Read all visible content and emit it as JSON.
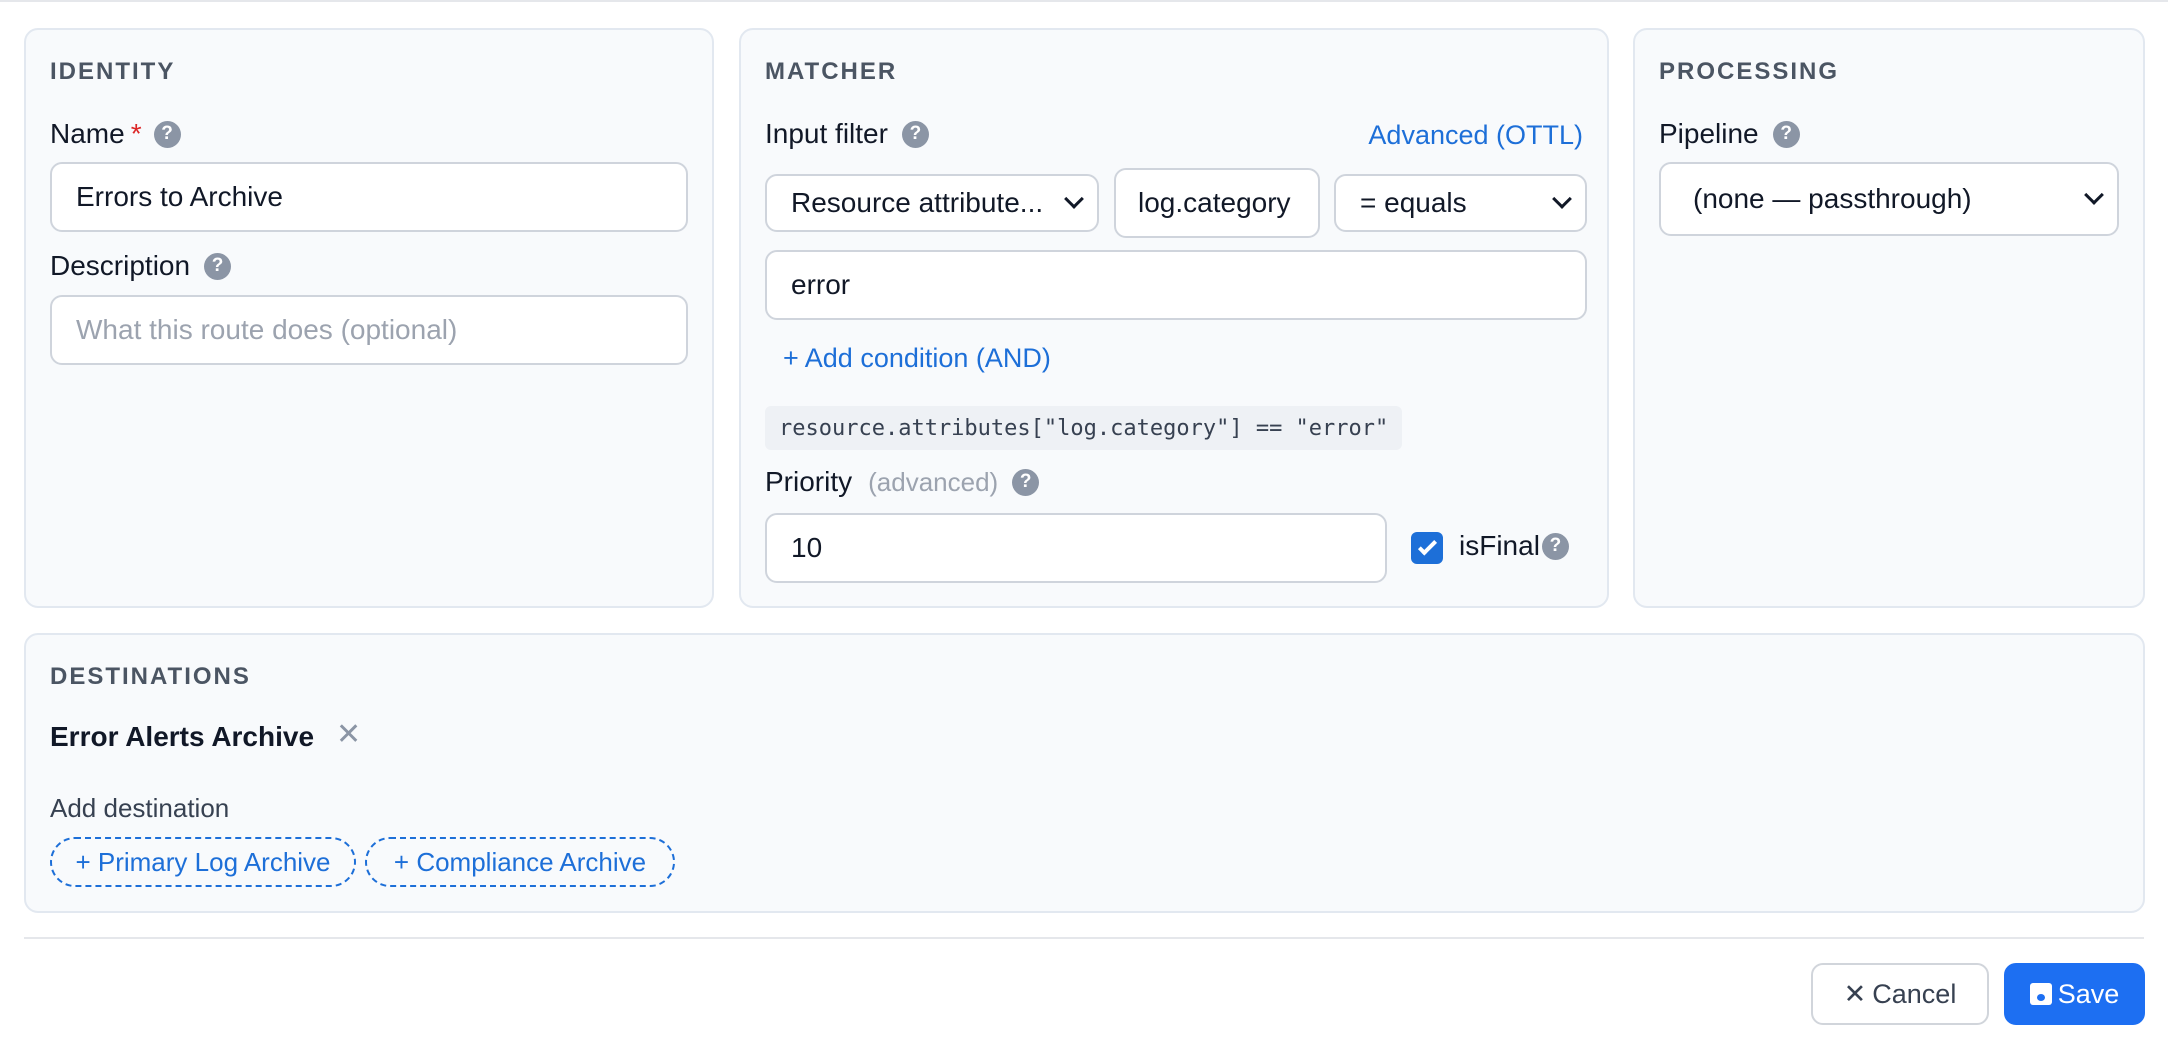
{
  "identity": {
    "title": "IDENTITY",
    "name_label": "Name",
    "required_mark": "*",
    "name_value": "Errors to Archive",
    "description_label": "Description",
    "description_placeholder": "What this route does (optional)"
  },
  "matcher": {
    "title": "MATCHER",
    "input_filter_label": "Input filter",
    "advanced_link": "Advanced (OTTL)",
    "source_select": "Resource attribute...",
    "key_value": "log.category",
    "operator_select": "= equals",
    "value": "error",
    "add_condition": "+ Add condition (AND)",
    "expression": "resource.attributes[\"log.category\"] == \"error\"",
    "priority_label": "Priority",
    "priority_hint": "(advanced)",
    "priority_value": "10",
    "is_final_label": "isFinal",
    "is_final_checked": true
  },
  "processing": {
    "title": "PROCESSING",
    "pipeline_label": "Pipeline",
    "pipeline_select": "(none — passthrough)"
  },
  "destinations": {
    "title": "DESTINATIONS",
    "selected": [
      "Error Alerts Archive"
    ],
    "add_label": "Add destination",
    "options": [
      "+ Primary Log Archive",
      "+ Compliance Archive"
    ]
  },
  "footer": {
    "cancel_label": "Cancel",
    "save_label": "Save"
  },
  "help_glyph": "?",
  "colors": {
    "accent": "#1d6ff2",
    "link": "#1d6fd8",
    "required": "#dc2626",
    "help_icon": "#8b95a5",
    "panel_bg": "#f8fafc",
    "panel_border": "#e2e8f0"
  }
}
